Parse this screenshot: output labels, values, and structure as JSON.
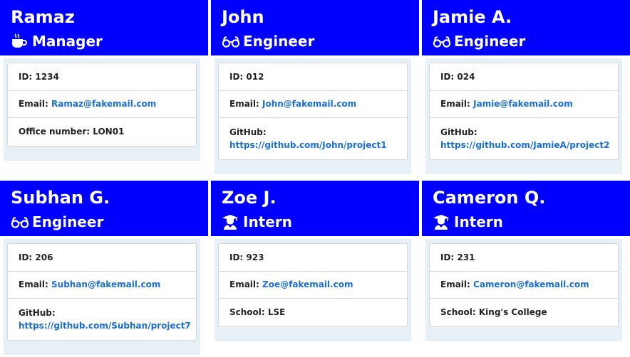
{
  "cards": [
    {
      "name": "Ramaz",
      "role": "Manager",
      "role_icon": "coffee-icon",
      "id_label": "ID: 1234",
      "email_label": "Email: ",
      "email": "Ramaz@fakemail.com",
      "extra_label": "Office number: LON01"
    },
    {
      "name": "John",
      "role": "Engineer",
      "role_icon": "glasses-icon",
      "id_label": "ID: 012",
      "email_label": "Email: ",
      "email": "John@fakemail.com",
      "extra_label": "GitHub:",
      "extra_link": "https://github.com/John/project1"
    },
    {
      "name": "Jamie A.",
      "role": "Engineer",
      "role_icon": "glasses-icon",
      "id_label": "ID: 024",
      "email_label": "Email: ",
      "email": "Jamie@fakemail.com",
      "extra_label": "GitHub:",
      "extra_link": "https://github.com/JamieA/project2"
    },
    {
      "name": "Subhan G.",
      "role": "Engineer",
      "role_icon": "glasses-icon",
      "id_label": "ID: 206",
      "email_label": "Email: ",
      "email": "Subhan@fakemail.com",
      "extra_label": "GitHub:",
      "extra_link": "https://github.com/Subhan/project7"
    },
    {
      "name": "Zoe J.",
      "role": "Intern",
      "role_icon": "graduate-icon",
      "id_label": "ID: 923",
      "email_label": "Email: ",
      "email": "Zoe@fakemail.com",
      "extra_label": "School: LSE"
    },
    {
      "name": "Cameron Q.",
      "role": "Intern",
      "role_icon": "graduate-icon",
      "id_label": "ID: 231",
      "email_label": "Email: ",
      "email": "Cameron@fakemail.com",
      "extra_label": "School: King's College"
    }
  ],
  "colors": {
    "header_bg": "#0000ff",
    "body_bg": "#e8f0f7",
    "link": "#1a6fd6"
  }
}
